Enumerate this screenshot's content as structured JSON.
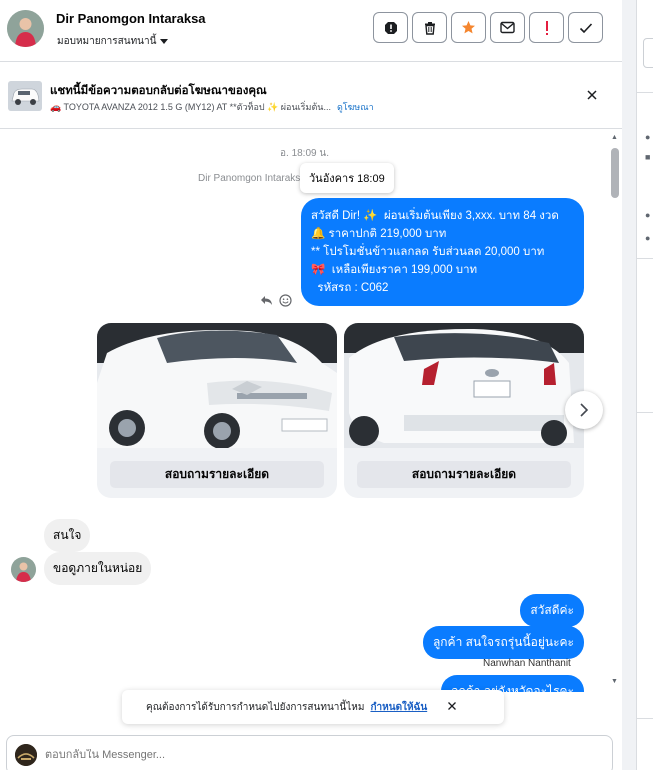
{
  "header": {
    "contact_name": "Dir Panomgon Intaraksa",
    "assign_label": "มอบหมายการสนทนานี้",
    "actions": [
      "report-icon",
      "trash-icon",
      "star-icon",
      "mail-icon",
      "exclamation-icon",
      "check-icon"
    ]
  },
  "ad_context": {
    "title": "แชทนี้มีข้อความตอบกลับต่อโฆษณาของคุณ",
    "ad_text": "🚗 TOYOTA AVANZA 2012 1.5 G (MY12) AT **ตัวท็อป ✨ ผ่อนเริ่มต้น...",
    "view_ad_label": "ดูโฆษณา"
  },
  "chat": {
    "time_separator": "อ. 18:09 น.",
    "sender_label": "Dir Panomgon Intaraksa",
    "tooltip": "วันอังคาร 18:09",
    "ad_message_lines": [
      "สวัสดี Dir! ✨  ผ่อนเริ่มต้นเพียง 3,xxx. บาท 84 งวด",
      "🔔 ราคาปกติ 219,000 บาท",
      "** โปรโมชั่นข้าวแลกลด รับส่วนลด 20,000 บาท",
      "🎀  เหลือเพียงราคา 199,000 บาท",
      "",
      "  รหัสรถ : C062"
    ],
    "cards": [
      {
        "button": "สอบถามรายละเอียด"
      },
      {
        "button": "สอบถามรายละเอียด"
      }
    ],
    "incoming": [
      "สนใจ",
      "ขอดูภายในหน่อย"
    ],
    "outgoing": [
      "สวัสดีค่ะ",
      "ลูกค้า  สนใจรถรุ่นนี้อยู่นะคะ",
      "ลูกค้า  อยู่จังหวัดอะไรคะ"
    ],
    "agent_name": "Nanwhan Nanthanit"
  },
  "toast": {
    "text": "คุณต้องการได้รับการกำหนดไปยังการสนทนานี้ไหม",
    "link": "กำหนดให้ฉัน"
  },
  "composer": {
    "placeholder": "ตอบกลับใน Messenger..."
  },
  "colors": {
    "messenger_blue": "#0a7cff",
    "star_orange": "#f5862f",
    "alert_red": "#e41e3f"
  }
}
